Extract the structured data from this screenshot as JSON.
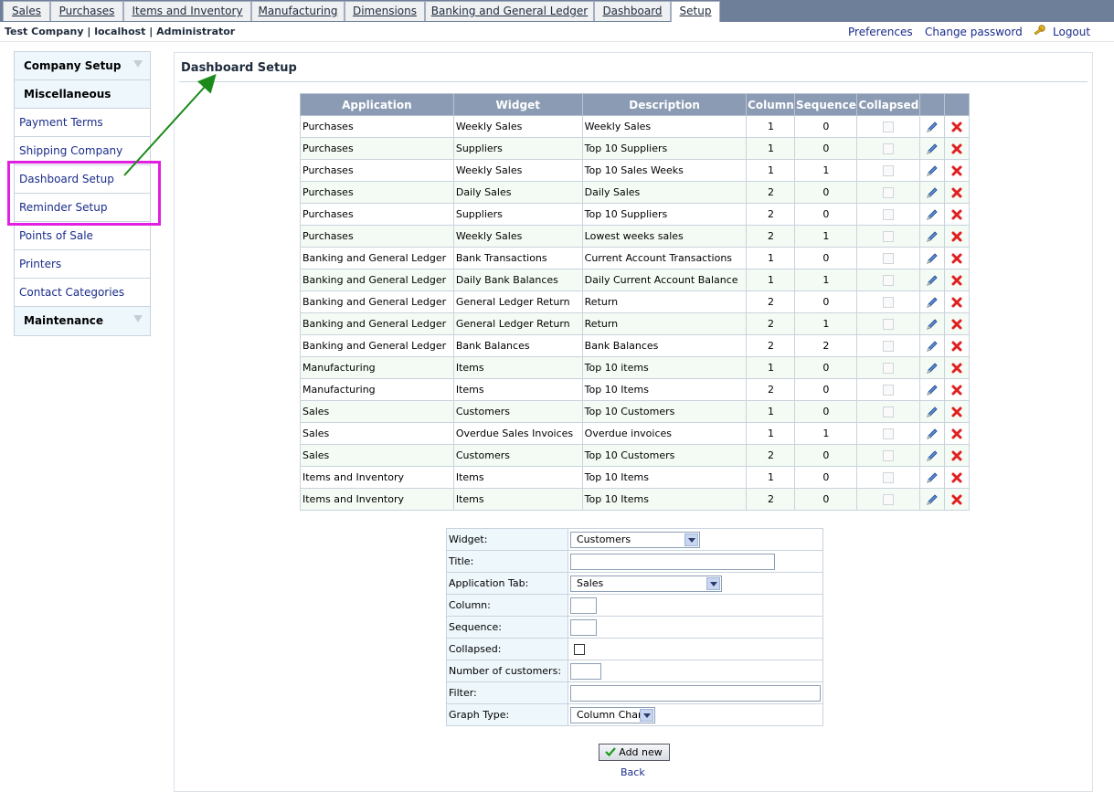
{
  "tabs": [
    {
      "label": "Sales",
      "active": false
    },
    {
      "label": "Purchases",
      "active": false
    },
    {
      "label": "Items and Inventory",
      "active": false
    },
    {
      "label": "Manufacturing",
      "active": false
    },
    {
      "label": "Dimensions",
      "active": false
    },
    {
      "label": "Banking and General Ledger",
      "active": false
    },
    {
      "label": "Dashboard",
      "active": false
    },
    {
      "label": "Setup",
      "active": true
    }
  ],
  "userbar": {
    "info": "Test Company | localhost | Administrator",
    "preferences": "Preferences",
    "change_password": "Change password",
    "logout": "Logout"
  },
  "sidebar": {
    "company_setup": "Company Setup",
    "miscellaneous": "Miscellaneous",
    "items": [
      "Payment Terms",
      "Shipping Company",
      "Dashboard Setup",
      "Reminder Setup",
      "Points of Sale",
      "Printers",
      "Contact Categories"
    ],
    "maintenance": "Maintenance"
  },
  "page": {
    "title": "Dashboard Setup"
  },
  "table": {
    "headers": [
      "Application",
      "Widget",
      "Description",
      "Column",
      "Sequence",
      "Collapsed",
      "",
      ""
    ],
    "rows": [
      [
        "Purchases",
        "Weekly Sales",
        "Weekly Sales",
        "1",
        "0"
      ],
      [
        "Purchases",
        "Suppliers",
        "Top 10 Suppliers",
        "1",
        "0"
      ],
      [
        "Purchases",
        "Weekly Sales",
        "Top 10 Sales Weeks",
        "1",
        "1"
      ],
      [
        "Purchases",
        "Daily Sales",
        "Daily Sales",
        "2",
        "0"
      ],
      [
        "Purchases",
        "Suppliers",
        "Top 10 Suppliers",
        "2",
        "0"
      ],
      [
        "Purchases",
        "Weekly Sales",
        "Lowest weeks sales",
        "2",
        "1"
      ],
      [
        "Banking and General Ledger",
        "Bank Transactions",
        "Current Account Transactions",
        "1",
        "0"
      ],
      [
        "Banking and General Ledger",
        "Daily Bank Balances",
        "Daily Current Account Balance",
        "1",
        "1"
      ],
      [
        "Banking and General Ledger",
        "General Ledger Return",
        "Return",
        "2",
        "0"
      ],
      [
        "Banking and General Ledger",
        "General Ledger Return",
        "Return",
        "2",
        "1"
      ],
      [
        "Banking and General Ledger",
        "Bank Balances",
        "Bank Balances",
        "2",
        "2"
      ],
      [
        "Manufacturing",
        "Items",
        "Top 10 items",
        "1",
        "0"
      ],
      [
        "Manufacturing",
        "Items",
        "Top 10 Items",
        "2",
        "0"
      ],
      [
        "Sales",
        "Customers",
        "Top 10 Customers",
        "1",
        "0"
      ],
      [
        "Sales",
        "Overdue Sales Invoices",
        "Overdue invoices",
        "1",
        "1"
      ],
      [
        "Sales",
        "Customers",
        "Top 10 Customers",
        "2",
        "0"
      ],
      [
        "Items and Inventory",
        "Items",
        "Top 10 Items",
        "1",
        "0"
      ],
      [
        "Items and Inventory",
        "Items",
        "Top 10 Items",
        "2",
        "0"
      ]
    ]
  },
  "form": {
    "widget_label": "Widget:",
    "widget_value": "Customers",
    "title_label": "Title:",
    "title_value": "",
    "app_tab_label": "Application Tab:",
    "app_tab_value": "Sales",
    "column_label": "Column:",
    "sequence_label": "Sequence:",
    "collapsed_label": "Collapsed:",
    "num_customers_label": "Number of customers:",
    "filter_label": "Filter:",
    "graph_type_label": "Graph Type:",
    "graph_type_value": "Column Chart"
  },
  "buttons": {
    "add_new": "Add new",
    "back": "Back"
  },
  "colors": {
    "highlight": "#e11fe0",
    "arrow": "#1a8a1a",
    "header_bg": "#8a9bb3",
    "delete": "#e02020",
    "edit": "#2a5db0"
  }
}
